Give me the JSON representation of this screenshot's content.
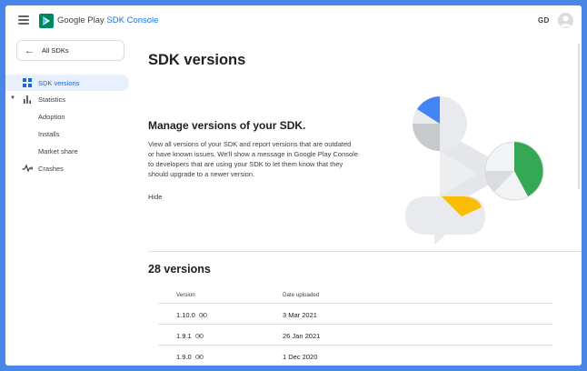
{
  "header": {
    "brand_part1": "Google Play",
    "brand_part2": "SDK Console",
    "user_initials": "GD"
  },
  "sidebar": {
    "back_label": "All SDKs",
    "items": [
      {
        "label": "SDK versions"
      },
      {
        "label": "Statistics"
      },
      {
        "label": "Adoption"
      },
      {
        "label": "Installs"
      },
      {
        "label": "Market share"
      },
      {
        "label": "Crashes"
      }
    ]
  },
  "main": {
    "title": "SDK versions",
    "intro_title": "Manage versions of your SDK.",
    "intro_body": "View all versions of your SDK and report versions that are outdated or have known issues. We'll show a message in Google Play Console to developers that are using your SDK to let them know that they should upgrade to a newer version.",
    "hide_label": "Hide",
    "versions_title": "28 versions",
    "table": {
      "columns": [
        "Version",
        "Date uploaded"
      ],
      "rows": [
        {
          "version": "1.10.0",
          "date": "3 Mar 2021"
        },
        {
          "version": "1.9.1",
          "date": "26 Jan 2021"
        },
        {
          "version": "1.9.0",
          "date": "1 Dec 2020"
        }
      ]
    }
  },
  "colors": {
    "accent": "#1a73e8",
    "active_bg": "#e8f0fe",
    "frame": "#4a86e8",
    "illus_blue": "#4285f4",
    "illus_green": "#34a853",
    "illus_yellow": "#fbbc04"
  },
  "icons": [
    "menu-icon",
    "google-play-logo-icon",
    "arrow-left-icon",
    "sdk-versions-icon",
    "bar-chart-icon",
    "crashes-icon",
    "link-icon"
  ]
}
